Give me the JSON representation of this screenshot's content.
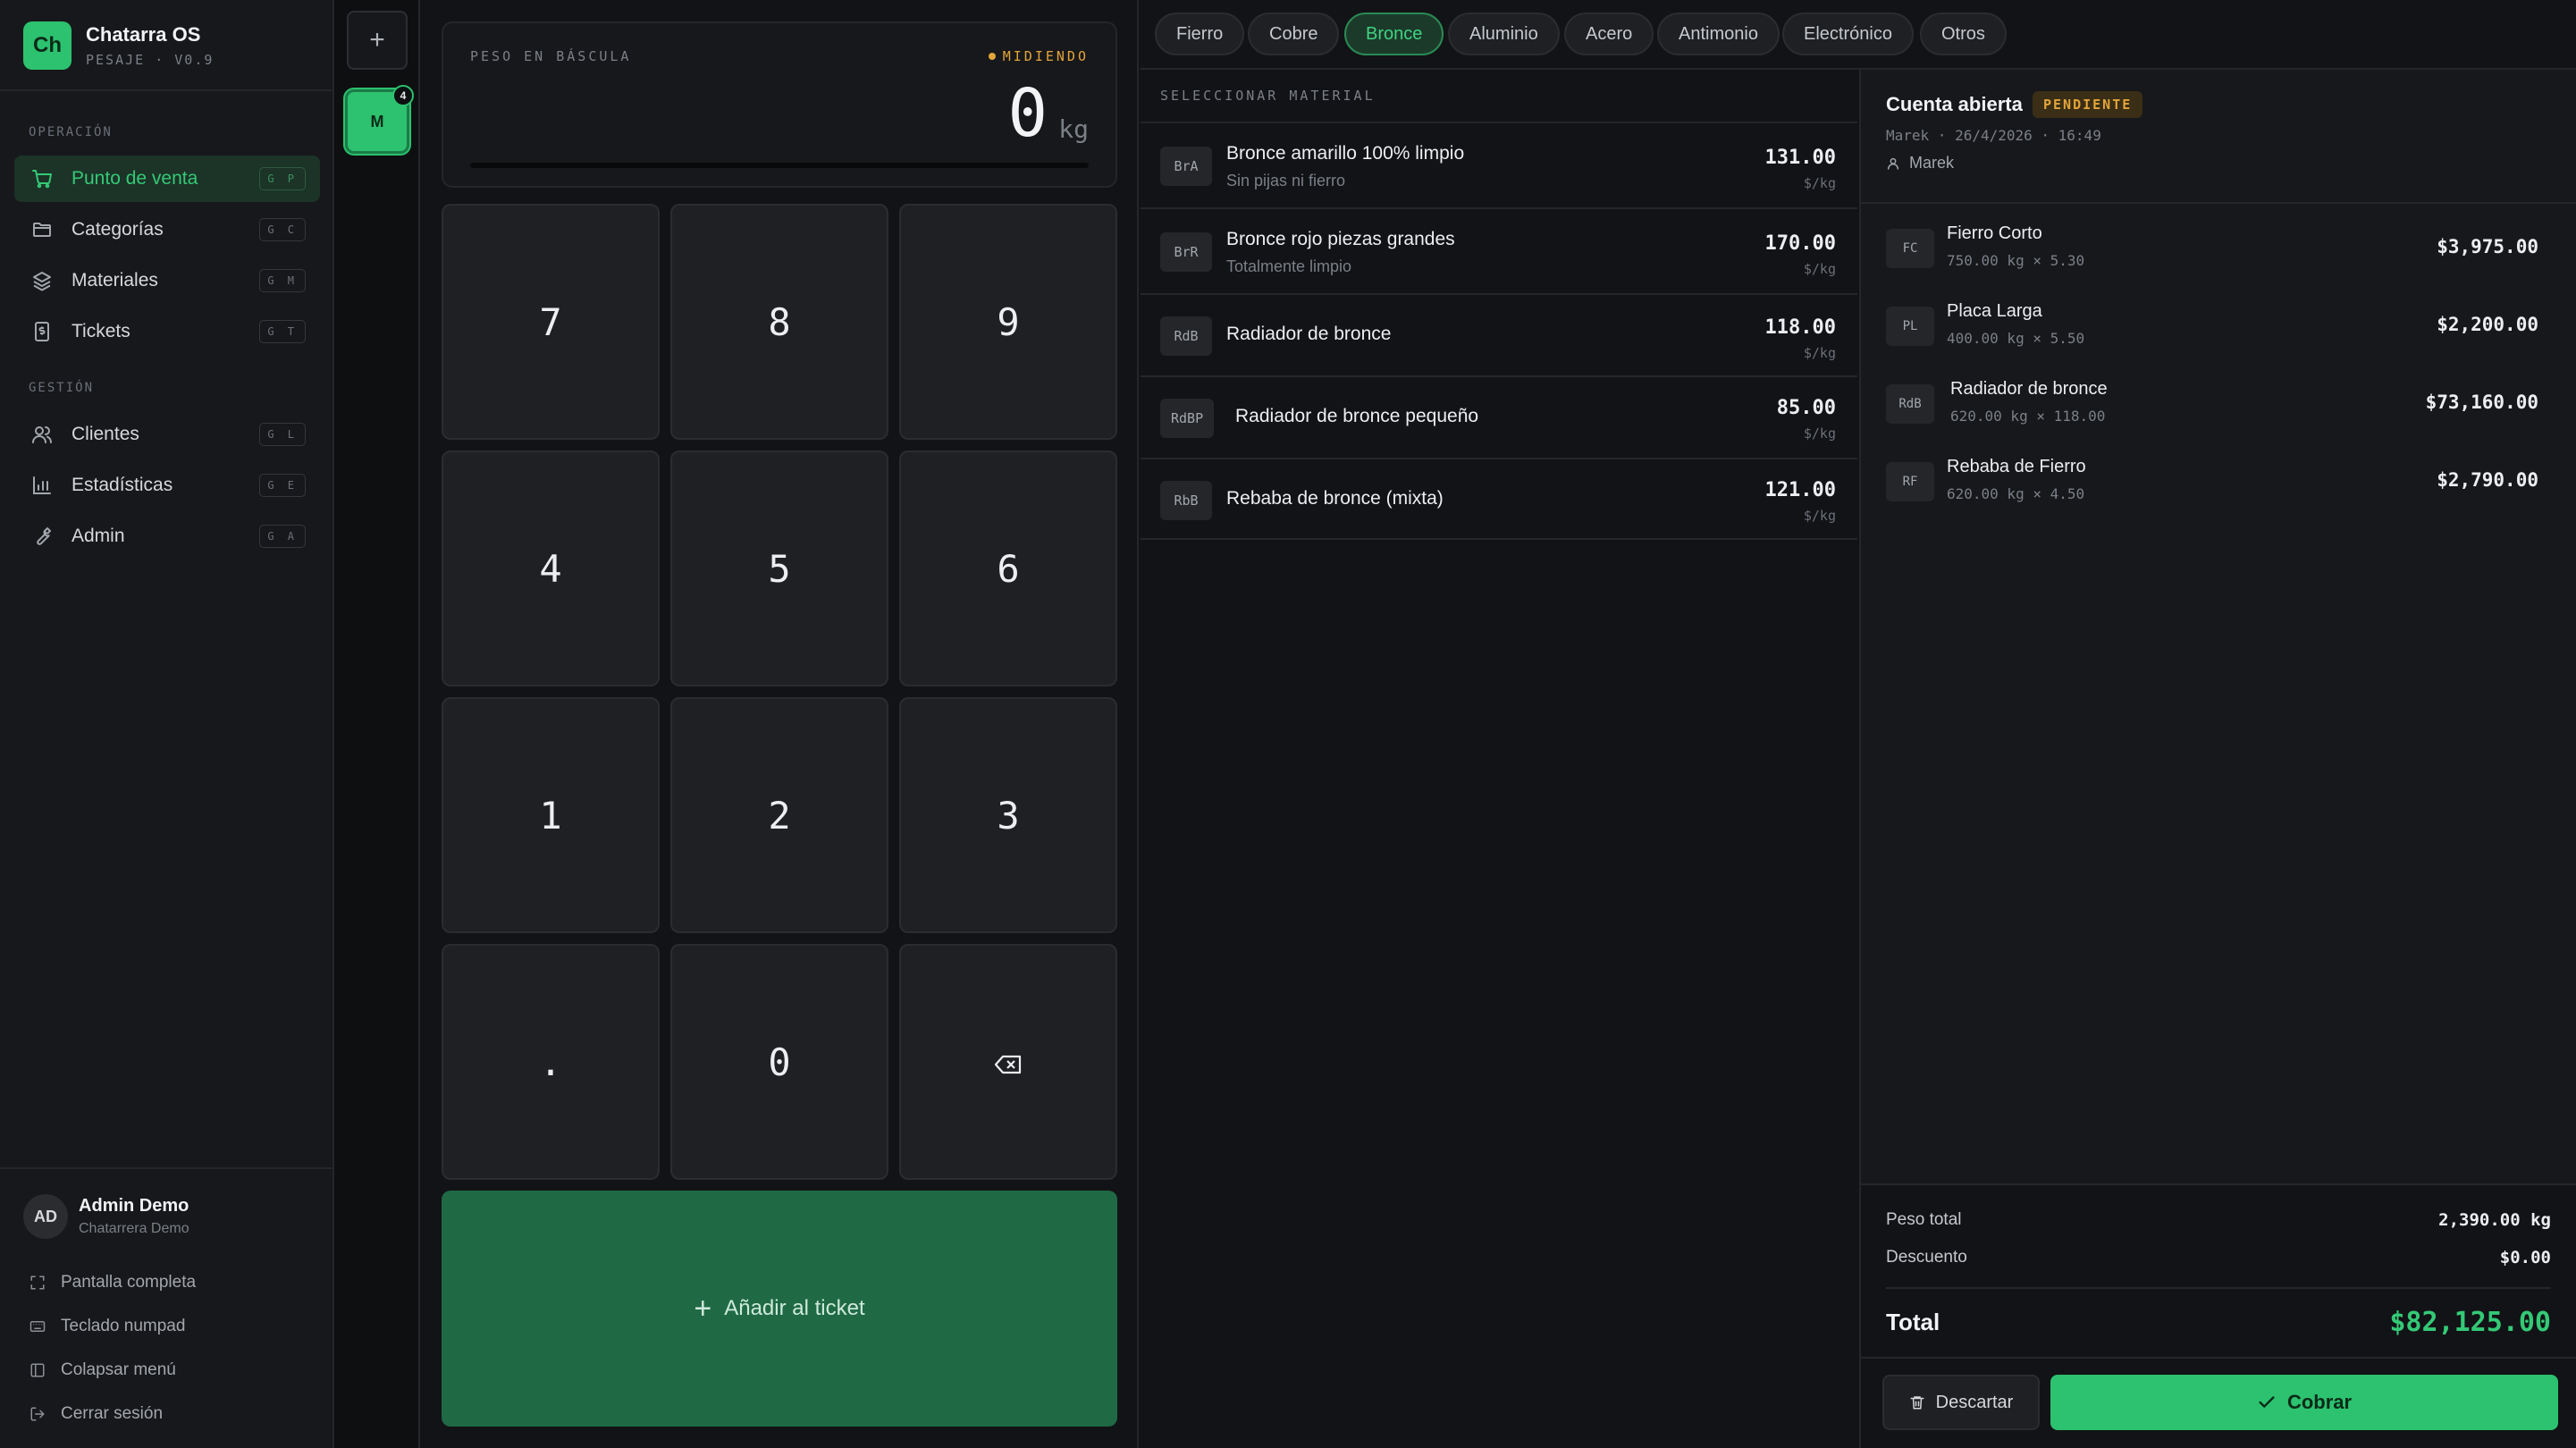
{
  "brand": {
    "logo": "Ch",
    "name": "Chatarra OS",
    "subtitle": "PESAJE · V0.9"
  },
  "sidebar": {
    "sections": [
      {
        "label": "OPERACIÓN"
      },
      {
        "label": "GESTIÓN"
      }
    ],
    "items": [
      {
        "label": "Punto de venta",
        "shortcut": "G P",
        "icon": "cart-icon",
        "active": true
      },
      {
        "label": "Categorías",
        "shortcut": "G C",
        "icon": "folder-icon"
      },
      {
        "label": "Materiales",
        "shortcut": "G M",
        "icon": "layers-icon"
      },
      {
        "label": "Tickets",
        "shortcut": "G T",
        "icon": "receipt-icon"
      },
      {
        "label": "Clientes",
        "shortcut": "G L",
        "icon": "users-icon"
      },
      {
        "label": "Estadísticas",
        "shortcut": "G E",
        "icon": "bar-chart-icon"
      },
      {
        "label": "Admin",
        "shortcut": "G A",
        "icon": "wrench-icon"
      }
    ],
    "user": {
      "initials": "AD",
      "name": "Admin Demo",
      "org": "Chatarrera Demo"
    },
    "footer_items": [
      {
        "label": "Pantalla completa",
        "icon": "fullscreen-icon"
      },
      {
        "label": "Teclado numpad",
        "icon": "keyboard-icon"
      },
      {
        "label": "Colapsar menú",
        "icon": "sidebar-collapse-icon"
      },
      {
        "label": "Cerrar sesión",
        "icon": "logout-icon"
      }
    ]
  },
  "tickets_column": {
    "new_label": "+",
    "tickets": [
      {
        "label": "M",
        "count": "4",
        "active": true
      }
    ]
  },
  "scale": {
    "label": "PESO EN BÁSCULA",
    "status": "MIDIENDO",
    "value": "0",
    "unit": "kg",
    "level": 0
  },
  "keypad": {
    "keys": [
      "7",
      "8",
      "9",
      "4",
      "5",
      "6",
      "1",
      "2",
      "3",
      ".",
      "0",
      "backspace"
    ],
    "add_label": "Añadir al ticket"
  },
  "categories": [
    {
      "label": "Fierro"
    },
    {
      "label": "Cobre"
    },
    {
      "label": "Bronce",
      "active": true
    },
    {
      "label": "Aluminio"
    },
    {
      "label": "Acero"
    },
    {
      "label": "Antimonio"
    },
    {
      "label": "Electrónico"
    },
    {
      "label": "Otros"
    }
  ],
  "materials": {
    "heading": "SELECCIONAR MATERIAL",
    "price_unit": "$/kg",
    "items": [
      {
        "code": "BrA",
        "name": "Bronce amarillo 100% limpio",
        "note": "Sin pijas ni fierro",
        "price": "131.00"
      },
      {
        "code": "BrR",
        "name": "Bronce rojo piezas grandes",
        "note": "Totalmente limpio",
        "price": "170.00"
      },
      {
        "code": "RdB",
        "name": "Radiador de bronce",
        "note": "",
        "price": "118.00"
      },
      {
        "code": "RdBP",
        "name": "Radiador de bronce pequeño",
        "note": "",
        "price": "85.00"
      },
      {
        "code": "RbB",
        "name": "Rebaba de bronce (mixta)",
        "note": "",
        "price": "121.00"
      }
    ]
  },
  "ticket": {
    "title": "Cuenta abierta",
    "status": "PENDIENTE",
    "meta": "Marek · 26/4/2026 · 16:49",
    "customer": "Marek",
    "lines": [
      {
        "code": "FC",
        "name": "Fierro Corto",
        "qty": "750.00 kg × 5.30",
        "total": "$3,975.00"
      },
      {
        "code": "PL",
        "name": "Placa Larga",
        "qty": "400.00 kg × 5.50",
        "total": "$2,200.00"
      },
      {
        "code": "RdB",
        "name": "Radiador de bronce",
        "qty": "620.00 kg × 118.00",
        "total": "$73,160.00"
      },
      {
        "code": "RF",
        "name": "Rebaba de Fierro",
        "qty": "620.00 kg × 4.50",
        "total": "$2,790.00"
      }
    ],
    "summary": {
      "weight_label": "Peso total",
      "weight": "2,390.00 kg",
      "discount_label": "Descuento",
      "discount": "$0.00",
      "total_label": "Total",
      "total": "$82,125.00"
    },
    "discard_label": "Descartar",
    "charge_label": "Cobrar"
  },
  "colors": {
    "accent": "#2cc26f",
    "pending": "#e3a53a",
    "background": "#121316"
  }
}
